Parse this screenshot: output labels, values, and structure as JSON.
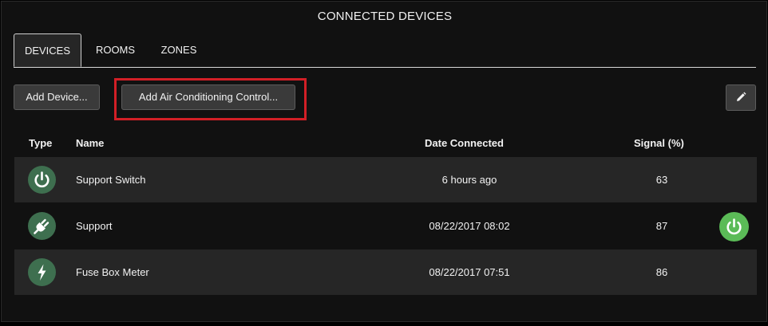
{
  "header": {
    "title": "CONNECTED DEVICES"
  },
  "tabs": [
    {
      "label": "DEVICES",
      "active": true
    },
    {
      "label": "ROOMS",
      "active": false
    },
    {
      "label": "ZONES",
      "active": false
    }
  ],
  "toolbar": {
    "add_device_label": "Add Device...",
    "add_ac_label": "Add Air Conditioning Control...",
    "edit_icon": "pencil-icon",
    "highlight_color": "#d21f26"
  },
  "table": {
    "columns": [
      "Type",
      "Name",
      "Date Connected",
      "Signal (%)"
    ],
    "rows": [
      {
        "type_icon": "power-icon",
        "name": "Support Switch",
        "date_connected": "6 hours ago",
        "signal": "63",
        "action": ""
      },
      {
        "type_icon": "plug-icon",
        "name": "Support",
        "date_connected": "08/22/2017 08:02",
        "signal": "87",
        "action": "power-icon"
      },
      {
        "type_icon": "lightning-icon",
        "name": "Fuse Box Meter",
        "date_connected": "08/22/2017 07:51",
        "signal": "86",
        "action": ""
      }
    ]
  },
  "colors": {
    "type_icon_bg": "#3e6f4f",
    "power_button_bg": "#5bbb57"
  }
}
